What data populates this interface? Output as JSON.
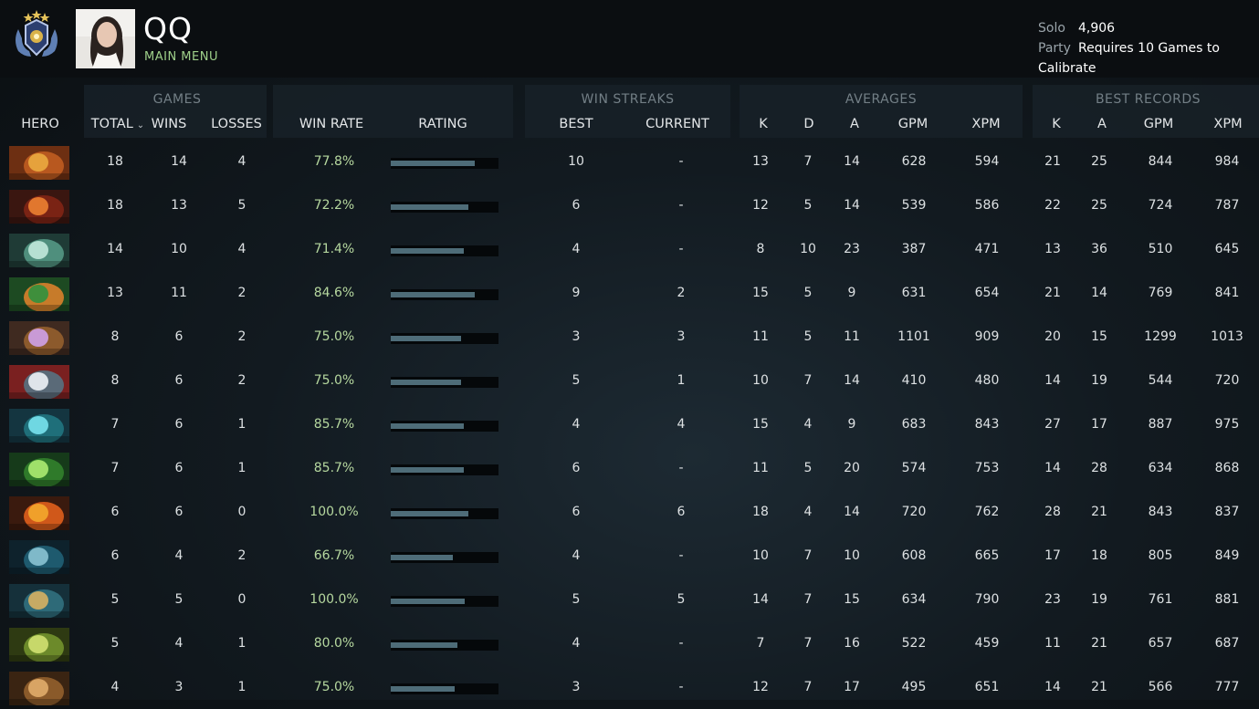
{
  "player": {
    "name": "QQ",
    "menu_link": "MAIN MENU"
  },
  "mmr": {
    "solo_label": "Solo",
    "solo_value": "4,906",
    "party_label": "Party",
    "party_value": "Requires 10 Games to Calibrate"
  },
  "groups": {
    "games": "GAMES",
    "win_streaks": "WIN STREAKS",
    "averages": "AVERAGES",
    "best_records": "BEST RECORDS"
  },
  "columns": {
    "hero": "HERO",
    "total": "TOTAL",
    "wins": "WINS",
    "losses": "LOSSES",
    "win_rate": "WIN RATE",
    "rating": "RATING",
    "best": "BEST",
    "current": "CURRENT",
    "avg_k": "K",
    "avg_d": "D",
    "avg_a": "A",
    "avg_gpm": "GPM",
    "avg_xpm": "XPM",
    "rec_k": "K",
    "rec_a": "A",
    "rec_gpm": "GPM",
    "rec_xpm": "XPM"
  },
  "colors": {
    "accent_green": "#9fd08a",
    "win_rate": "#b6d89f",
    "rating_bar": "#4e6c78"
  },
  "rows": [
    {
      "hero_icon": "hero-portrait-1",
      "total": "18",
      "wins": "14",
      "losses": "4",
      "win_rate": "77.8%",
      "rating": 0.78,
      "best": "10",
      "current": "-",
      "avg_k": "13",
      "avg_d": "7",
      "avg_a": "14",
      "avg_gpm": "628",
      "avg_xpm": "594",
      "rec_k": "21",
      "rec_a": "25",
      "rec_gpm": "844",
      "rec_xpm": "984"
    },
    {
      "hero_icon": "hero-portrait-2",
      "total": "18",
      "wins": "13",
      "losses": "5",
      "win_rate": "72.2%",
      "rating": 0.72,
      "best": "6",
      "current": "-",
      "avg_k": "12",
      "avg_d": "5",
      "avg_a": "14",
      "avg_gpm": "539",
      "avg_xpm": "586",
      "rec_k": "22",
      "rec_a": "25",
      "rec_gpm": "724",
      "rec_xpm": "787"
    },
    {
      "hero_icon": "hero-portrait-3",
      "total": "14",
      "wins": "10",
      "losses": "4",
      "win_rate": "71.4%",
      "rating": 0.68,
      "best": "4",
      "current": "-",
      "avg_k": "8",
      "avg_d": "10",
      "avg_a": "23",
      "avg_gpm": "387",
      "avg_xpm": "471",
      "rec_k": "13",
      "rec_a": "36",
      "rec_gpm": "510",
      "rec_xpm": "645"
    },
    {
      "hero_icon": "hero-portrait-4",
      "total": "13",
      "wins": "11",
      "losses": "2",
      "win_rate": "84.6%",
      "rating": 0.78,
      "best": "9",
      "current": "2",
      "avg_k": "15",
      "avg_d": "5",
      "avg_a": "9",
      "avg_gpm": "631",
      "avg_xpm": "654",
      "rec_k": "21",
      "rec_a": "14",
      "rec_gpm": "769",
      "rec_xpm": "841"
    },
    {
      "hero_icon": "hero-portrait-5",
      "total": "8",
      "wins": "6",
      "losses": "2",
      "win_rate": "75.0%",
      "rating": 0.65,
      "best": "3",
      "current": "3",
      "avg_k": "11",
      "avg_d": "5",
      "avg_a": "11",
      "avg_gpm": "1101",
      "avg_xpm": "909",
      "rec_k": "20",
      "rec_a": "15",
      "rec_gpm": "1299",
      "rec_xpm": "1013"
    },
    {
      "hero_icon": "hero-portrait-6",
      "total": "8",
      "wins": "6",
      "losses": "2",
      "win_rate": "75.0%",
      "rating": 0.65,
      "best": "5",
      "current": "1",
      "avg_k": "10",
      "avg_d": "7",
      "avg_a": "14",
      "avg_gpm": "410",
      "avg_xpm": "480",
      "rec_k": "14",
      "rec_a": "19",
      "rec_gpm": "544",
      "rec_xpm": "720"
    },
    {
      "hero_icon": "hero-portrait-7",
      "total": "7",
      "wins": "6",
      "losses": "1",
      "win_rate": "85.7%",
      "rating": 0.68,
      "best": "4",
      "current": "4",
      "avg_k": "15",
      "avg_d": "4",
      "avg_a": "9",
      "avg_gpm": "683",
      "avg_xpm": "843",
      "rec_k": "27",
      "rec_a": "17",
      "rec_gpm": "887",
      "rec_xpm": "975"
    },
    {
      "hero_icon": "hero-portrait-8",
      "total": "7",
      "wins": "6",
      "losses": "1",
      "win_rate": "85.7%",
      "rating": 0.68,
      "best": "6",
      "current": "-",
      "avg_k": "11",
      "avg_d": "5",
      "avg_a": "20",
      "avg_gpm": "574",
      "avg_xpm": "753",
      "rec_k": "14",
      "rec_a": "28",
      "rec_gpm": "634",
      "rec_xpm": "868"
    },
    {
      "hero_icon": "hero-portrait-9",
      "total": "6",
      "wins": "6",
      "losses": "0",
      "win_rate": "100.0%",
      "rating": 0.72,
      "best": "6",
      "current": "6",
      "avg_k": "18",
      "avg_d": "4",
      "avg_a": "14",
      "avg_gpm": "720",
      "avg_xpm": "762",
      "rec_k": "28",
      "rec_a": "21",
      "rec_gpm": "843",
      "rec_xpm": "837"
    },
    {
      "hero_icon": "hero-portrait-10",
      "total": "6",
      "wins": "4",
      "losses": "2",
      "win_rate": "66.7%",
      "rating": 0.58,
      "best": "4",
      "current": "-",
      "avg_k": "10",
      "avg_d": "7",
      "avg_a": "10",
      "avg_gpm": "608",
      "avg_xpm": "665",
      "rec_k": "17",
      "rec_a": "18",
      "rec_gpm": "805",
      "rec_xpm": "849"
    },
    {
      "hero_icon": "hero-portrait-11",
      "total": "5",
      "wins": "5",
      "losses": "0",
      "win_rate": "100.0%",
      "rating": 0.69,
      "best": "5",
      "current": "5",
      "avg_k": "14",
      "avg_d": "7",
      "avg_a": "15",
      "avg_gpm": "634",
      "avg_xpm": "790",
      "rec_k": "23",
      "rec_a": "19",
      "rec_gpm": "761",
      "rec_xpm": "881"
    },
    {
      "hero_icon": "hero-portrait-12",
      "total": "5",
      "wins": "4",
      "losses": "1",
      "win_rate": "80.0%",
      "rating": 0.62,
      "best": "4",
      "current": "-",
      "avg_k": "7",
      "avg_d": "7",
      "avg_a": "16",
      "avg_gpm": "522",
      "avg_xpm": "459",
      "rec_k": "11",
      "rec_a": "21",
      "rec_gpm": "657",
      "rec_xpm": "687"
    },
    {
      "hero_icon": "hero-portrait-13",
      "total": "4",
      "wins": "3",
      "losses": "1",
      "win_rate": "75.0%",
      "rating": 0.59,
      "best": "3",
      "current": "-",
      "avg_k": "12",
      "avg_d": "7",
      "avg_a": "17",
      "avg_gpm": "495",
      "avg_xpm": "651",
      "rec_k": "14",
      "rec_a": "21",
      "rec_gpm": "566",
      "rec_xpm": "777"
    }
  ]
}
